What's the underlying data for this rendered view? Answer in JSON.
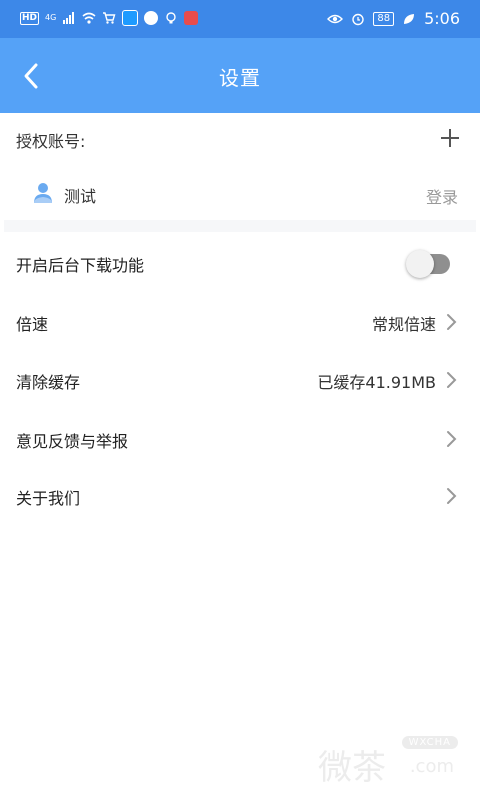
{
  "status_bar": {
    "hd_badge": "HD",
    "network": "4G",
    "battery": "88",
    "time": "5:06",
    "icons": [
      "signal-icon",
      "wifi-icon",
      "cart-app-icon",
      "search-app-icon",
      "chat-app-icon",
      "bulb-app-icon",
      "red-app-icon",
      "eye-icon",
      "alarm-icon",
      "leaf-icon"
    ]
  },
  "header": {
    "title": "设置",
    "back_icon": "chevron-left-icon"
  },
  "account": {
    "section_label": "授权账号:",
    "add_icon": "plus-icon",
    "user_icon": "user-icon",
    "name": "测试",
    "login_label": "登录"
  },
  "settings": {
    "background_download": {
      "label": "开启后台下载功能",
      "enabled": false
    },
    "speed": {
      "label": "倍速",
      "value": "常规倍速"
    },
    "clear_cache": {
      "label": "清除缓存",
      "value": "已缓存41.91MB"
    },
    "feedback": {
      "label": "意见反馈与举报"
    },
    "about": {
      "label": "关于我们"
    }
  },
  "watermark": {
    "main": "微茶",
    "badge": "WXCHA",
    "suffix": ".com"
  },
  "colors": {
    "status_bar": "#3d88e8",
    "header": "#55a2f7",
    "user_icon": "#6aaaf0"
  }
}
